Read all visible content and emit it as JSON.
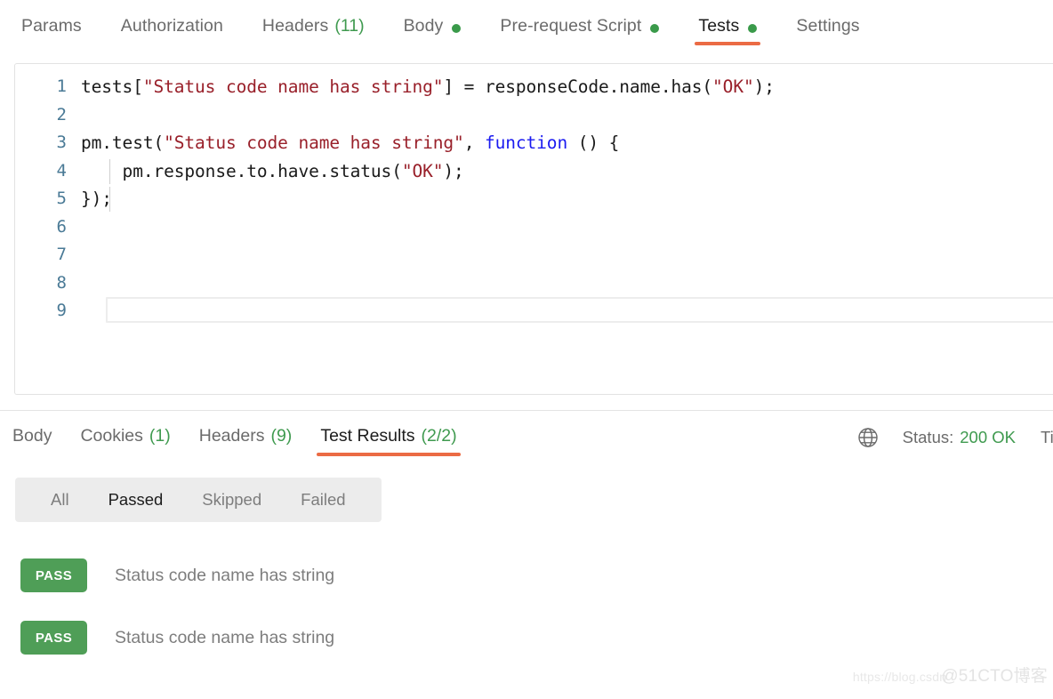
{
  "request_tabs": [
    {
      "label": "Params",
      "count": "",
      "dot": false,
      "active": false
    },
    {
      "label": "Authorization",
      "count": "",
      "dot": false,
      "active": false
    },
    {
      "label": "Headers",
      "count": "(11)",
      "dot": false,
      "active": false
    },
    {
      "label": "Body",
      "count": "",
      "dot": true,
      "active": false
    },
    {
      "label": "Pre-request Script",
      "count": "",
      "dot": true,
      "active": false
    },
    {
      "label": "Tests",
      "count": "",
      "dot": true,
      "active": true
    },
    {
      "label": "Settings",
      "count": "",
      "dot": false,
      "active": false
    }
  ],
  "editor": {
    "lines": [
      {
        "num": "1",
        "tokens": [
          {
            "t": "tests[",
            "c": "pl"
          },
          {
            "t": "\"Status code name has string\"",
            "c": "str"
          },
          {
            "t": "] = responseCode.name.has(",
            "c": "pl"
          },
          {
            "t": "\"OK\"",
            "c": "str"
          },
          {
            "t": ");",
            "c": "pl"
          }
        ]
      },
      {
        "num": "2",
        "tokens": []
      },
      {
        "num": "3",
        "tokens": [
          {
            "t": "pm.test(",
            "c": "pl"
          },
          {
            "t": "\"Status code name has string\"",
            "c": "str"
          },
          {
            "t": ", ",
            "c": "pl"
          },
          {
            "t": "function",
            "c": "kw"
          },
          {
            "t": " () {",
            "c": "pl"
          }
        ]
      },
      {
        "num": "4",
        "tokens": [
          {
            "t": "    pm.response.to.have.status(",
            "c": "pl"
          },
          {
            "t": "\"OK\"",
            "c": "str"
          },
          {
            "t": ");",
            "c": "pl"
          }
        ]
      },
      {
        "num": "5",
        "tokens": [
          {
            "t": "});",
            "c": "pl"
          }
        ]
      },
      {
        "num": "6",
        "tokens": []
      },
      {
        "num": "7",
        "tokens": []
      },
      {
        "num": "8",
        "tokens": []
      },
      {
        "num": "9",
        "tokens": []
      }
    ],
    "active_line_index": 8,
    "indent_guide_lines": [
      3,
      4
    ]
  },
  "response_tabs": [
    {
      "label": "Body",
      "count": "",
      "active": false
    },
    {
      "label": "Cookies",
      "count": "(1)",
      "active": false
    },
    {
      "label": "Headers",
      "count": "(9)",
      "active": false
    },
    {
      "label": "Test Results",
      "count": "(2/2)",
      "active": true
    }
  ],
  "status": {
    "globe_icon": "globe-icon",
    "label": "Status:",
    "value": "200 OK",
    "time_label": "Time:"
  },
  "filters": [
    {
      "label": "All",
      "active": false
    },
    {
      "label": "Passed",
      "active": true
    },
    {
      "label": "Skipped",
      "active": false
    },
    {
      "label": "Failed",
      "active": false
    }
  ],
  "results": [
    {
      "status": "PASS",
      "name": "Status code name has string"
    },
    {
      "status": "PASS",
      "name": "Status code name has string"
    }
  ],
  "watermark": {
    "left": "https://blog.csdn",
    "right": "@51CTO博客"
  },
  "colors": {
    "accent_underline": "#eb6b44",
    "pass_green": "#4f9e57",
    "count_green": "#3f9a4f",
    "string_token": "#99202a",
    "keyword_token": "#1b1bf0",
    "gutter_number": "#4a7a96"
  }
}
